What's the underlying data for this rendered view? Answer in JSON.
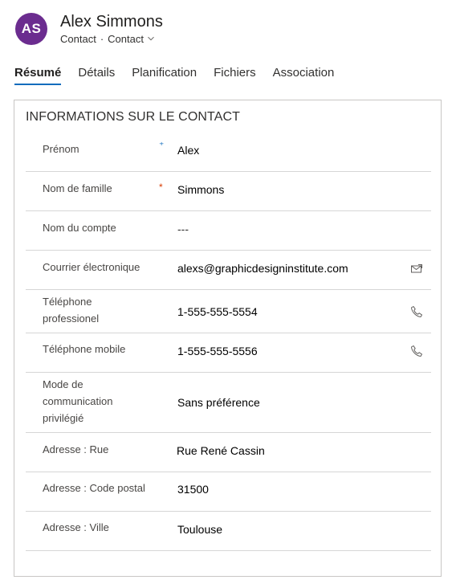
{
  "header": {
    "avatar_initials": "AS",
    "name": "Alex Simmons",
    "entity": "Contact",
    "form": "Contact"
  },
  "tabs": [
    {
      "label": "Résumé",
      "active": true
    },
    {
      "label": "Détails"
    },
    {
      "label": "Planification"
    },
    {
      "label": "Fichiers"
    },
    {
      "label": "Association"
    }
  ],
  "section": {
    "title": "INFORMATIONS SUR LE CONTACT",
    "fields": [
      {
        "label": "Prénom",
        "required": "⁺",
        "value": "Alex"
      },
      {
        "label": "Nom de famille",
        "required": "*",
        "value": "Simmons"
      },
      {
        "label": "Nom du compte",
        "value": "---"
      },
      {
        "label": "Courrier électronique",
        "value": "alexs@graphicdesigninstitute.com",
        "action": "mail-icon"
      },
      {
        "label": "Téléphone professionel",
        "value": "1-555-555-5554",
        "action": "phone-icon"
      },
      {
        "label": "Téléphone mobile",
        "value": "1-555-555-5556",
        "action": "phone-icon"
      },
      {
        "label": "Mode de communication privilégié",
        "value": "Sans préférence"
      },
      {
        "label": "Adresse : Rue",
        "value": "Rue René Cassin"
      },
      {
        "label": "Adresse : Code postal",
        "value": "31500"
      },
      {
        "label": "Adresse : Ville",
        "value": "Toulouse"
      }
    ]
  },
  "colors": {
    "avatar_bg": "#6b2c8f",
    "tab_underline": "#0f6cbd",
    "required_recommended": "#0f6cbd",
    "required_mandatory": "#d83b01"
  }
}
